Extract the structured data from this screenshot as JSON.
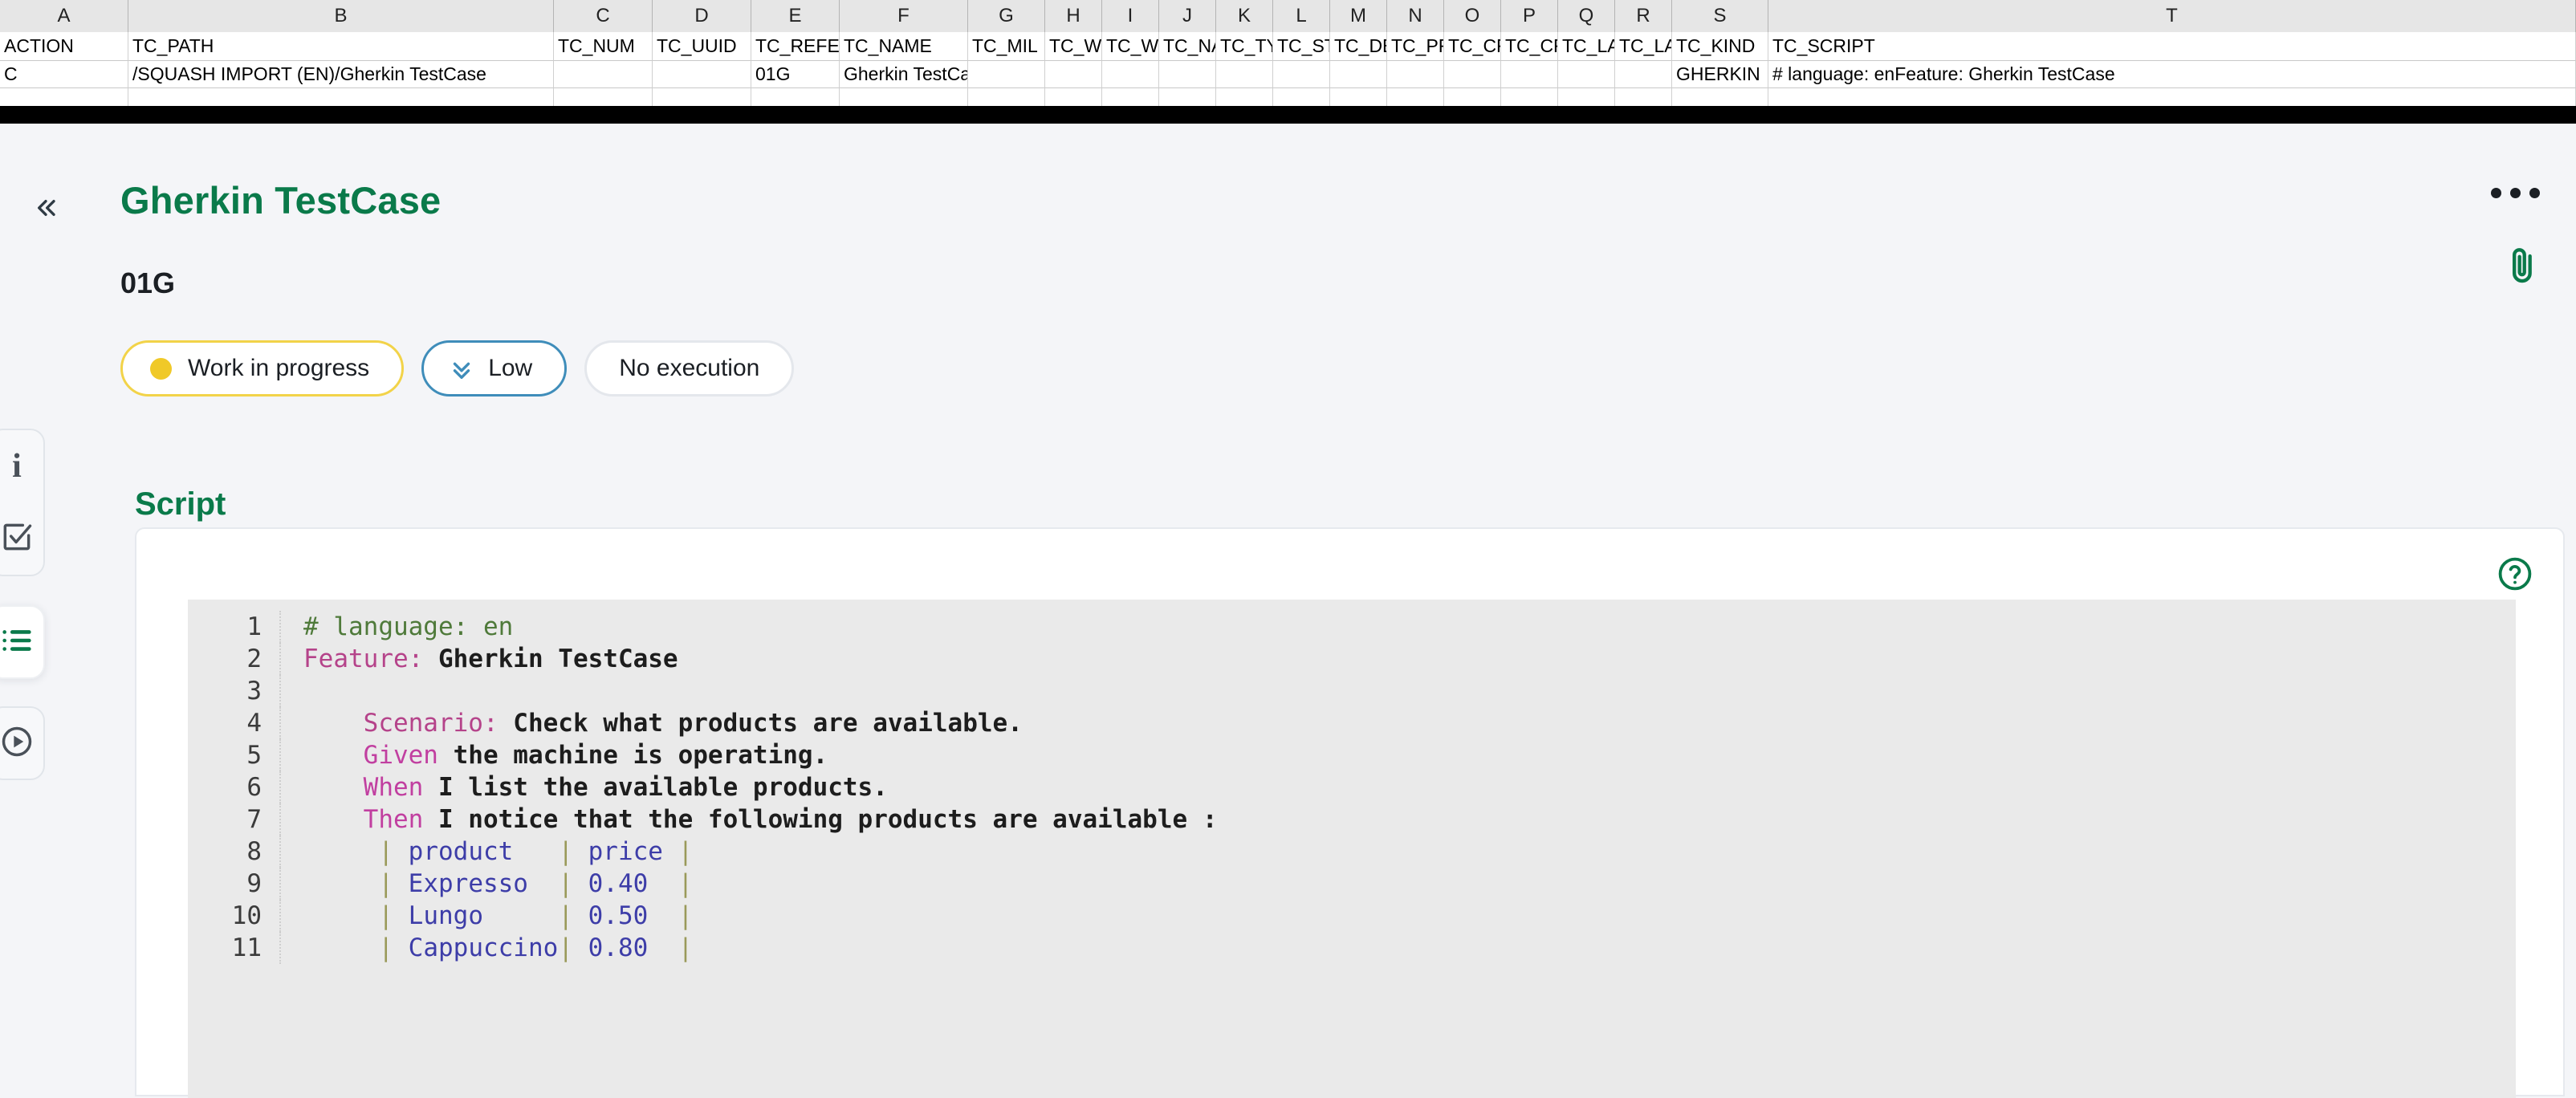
{
  "spreadsheet": {
    "column_letters": [
      "A",
      "B",
      "C",
      "D",
      "E",
      "F",
      "G",
      "H",
      "I",
      "J",
      "K",
      "L",
      "M",
      "N",
      "O",
      "P",
      "Q",
      "R",
      "S",
      "T"
    ],
    "header_row": [
      "ACTION",
      "TC_PATH",
      "TC_NUM",
      "TC_UUID",
      "TC_REFE",
      "TC_NAME",
      "TC_MIL",
      "TC_WE",
      "TC_WE",
      "TC_NA",
      "TC_TYF",
      "TC_ST/",
      "TC_DE",
      "TC_PR",
      "TC_CR",
      "TC_CR",
      "TC_LA\u0001",
      "TC_LA\u0001",
      "TC_KIND",
      "TC_SCRIPT"
    ],
    "data_row": [
      "C",
      "/SQUASH IMPORT (EN)/Gherkin TestCase",
      "",
      "",
      "01G",
      "Gherkin TestCase",
      "",
      "",
      "",
      "",
      "",
      "",
      "",
      "",
      "",
      "",
      "",
      "",
      "GHERKIN",
      "# language: enFeature: Gherkin TestCase"
    ]
  },
  "header": {
    "collapse_icon": "chevron-double-left-icon",
    "title": "Gherkin TestCase",
    "reference": "01G",
    "kebab_icon": "more-options-icon",
    "attachment_icon": "paperclip-icon"
  },
  "badges": {
    "status": {
      "label": "Work in progress",
      "dot_color": "#f0c928",
      "border_color": "#f2d349"
    },
    "priority": {
      "label": "Low",
      "icon": "chevron-double-down-icon",
      "border_color": "#3f8dba"
    },
    "execution": {
      "label": "No execution",
      "border_color": "#e4e7ec"
    }
  },
  "sidebar": {
    "items": [
      {
        "icon": "info-icon",
        "name": "information",
        "active": false
      },
      {
        "icon": "checkbox-check-icon",
        "name": "test-steps",
        "active": false
      },
      {
        "icon": "list-icon",
        "name": "script",
        "active": true
      },
      {
        "icon": "play-circle-icon",
        "name": "executions",
        "active": false
      }
    ],
    "active_color": "#0a7a4a"
  },
  "script": {
    "section_title": "Script",
    "help_icon": "help-circle-icon",
    "lines": [
      {
        "n": "1",
        "tokens": [
          {
            "t": "# language: en",
            "c": "k-comment"
          }
        ]
      },
      {
        "n": "2",
        "tokens": [
          {
            "t": "Feature:",
            "c": "k-key"
          },
          {
            "t": " Gherkin TestCase",
            "c": "k-plain"
          }
        ]
      },
      {
        "n": "3",
        "tokens": [
          {
            "t": "",
            "c": "k-plain"
          }
        ]
      },
      {
        "n": "4",
        "tokens": [
          {
            "t": "    ",
            "c": "k-plain"
          },
          {
            "t": "Scenario:",
            "c": "k-key"
          },
          {
            "t": " Check what products are available.",
            "c": "k-plain"
          }
        ]
      },
      {
        "n": "5",
        "tokens": [
          {
            "t": "    ",
            "c": "k-plain"
          },
          {
            "t": "Given",
            "c": "k-step"
          },
          {
            "t": " the machine is operating.",
            "c": "k-plain"
          }
        ]
      },
      {
        "n": "6",
        "tokens": [
          {
            "t": "    ",
            "c": "k-plain"
          },
          {
            "t": "When",
            "c": "k-step"
          },
          {
            "t": " I list the available products.",
            "c": "k-plain"
          }
        ]
      },
      {
        "n": "7",
        "tokens": [
          {
            "t": "    ",
            "c": "k-plain"
          },
          {
            "t": "Then",
            "c": "k-step"
          },
          {
            "t": " I notice that the following products are available :",
            "c": "k-plain"
          }
        ]
      },
      {
        "n": "8",
        "tokens": [
          {
            "t": "     ",
            "c": "k-plain"
          },
          {
            "t": "|",
            "c": "k-pipe"
          },
          {
            "t": " product   ",
            "c": "k-cell"
          },
          {
            "t": "|",
            "c": "k-pipe"
          },
          {
            "t": " price ",
            "c": "k-cell"
          },
          {
            "t": "|",
            "c": "k-pipe"
          }
        ]
      },
      {
        "n": "9",
        "tokens": [
          {
            "t": "     ",
            "c": "k-plain"
          },
          {
            "t": "|",
            "c": "k-pipe"
          },
          {
            "t": " Expresso  ",
            "c": "k-cell"
          },
          {
            "t": "|",
            "c": "k-pipe"
          },
          {
            "t": " 0.40  ",
            "c": "k-cell"
          },
          {
            "t": "|",
            "c": "k-pipe"
          }
        ]
      },
      {
        "n": "10",
        "tokens": [
          {
            "t": "     ",
            "c": "k-plain"
          },
          {
            "t": "|",
            "c": "k-pipe"
          },
          {
            "t": " Lungo     ",
            "c": "k-cell"
          },
          {
            "t": "|",
            "c": "k-pipe"
          },
          {
            "t": " 0.50  ",
            "c": "k-cell"
          },
          {
            "t": "|",
            "c": "k-pipe"
          }
        ]
      },
      {
        "n": "11",
        "tokens": [
          {
            "t": "     ",
            "c": "k-plain"
          },
          {
            "t": "|",
            "c": "k-pipe"
          },
          {
            "t": " Cappuccino",
            "c": "k-cell"
          },
          {
            "t": "|",
            "c": "k-pipe"
          },
          {
            "t": " 0.80  ",
            "c": "k-cell"
          },
          {
            "t": "|",
            "c": "k-pipe"
          }
        ]
      }
    ]
  },
  "colors": {
    "brand_green": "#0a7a4a",
    "page_bg": "#f4f5f8",
    "code_bg": "#eaeaea"
  }
}
